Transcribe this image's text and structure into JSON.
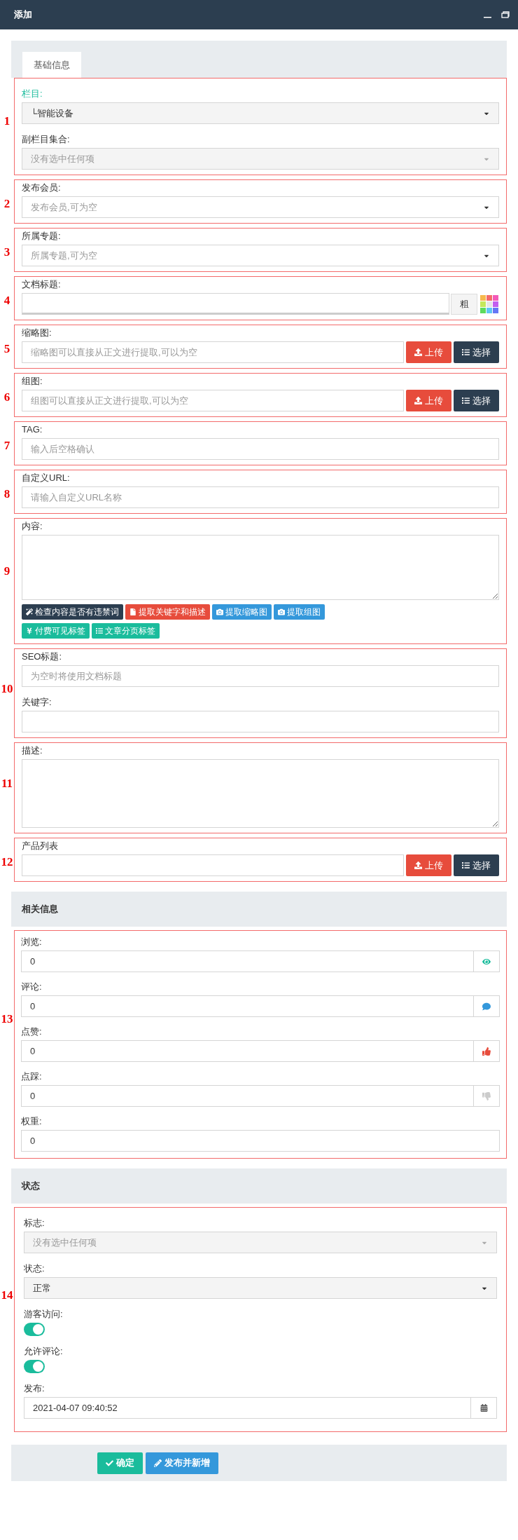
{
  "window": {
    "title": "添加"
  },
  "tabs": [
    {
      "label": "基础信息",
      "selected": true
    }
  ],
  "basic_groups": [
    {
      "number": "1",
      "fields": [
        {
          "kind": "select",
          "label": "栏目:",
          "focused": true,
          "value": "└智能设备",
          "disabled": false
        },
        {
          "kind": "select",
          "label": "副栏目集合:",
          "focused": false,
          "placeholder": "没有选中任何项",
          "disabled": true
        }
      ]
    },
    {
      "number": "2",
      "fields": [
        {
          "kind": "select",
          "label": "发布会员:",
          "focused": false,
          "placeholder": "发布会员,可为空",
          "disabled": false
        }
      ]
    },
    {
      "number": "3",
      "fields": [
        {
          "kind": "select",
          "label": "所属专题:",
          "focused": false,
          "placeholder": "所属专题,可为空",
          "disabled": false
        }
      ]
    },
    {
      "number": "4",
      "fields": [
        {
          "kind": "title",
          "label": "文档标题:",
          "focused": false,
          "bold_button": "粗"
        }
      ]
    },
    {
      "number": "5",
      "fields": [
        {
          "kind": "upload",
          "label": "缩略图:",
          "focused": false,
          "placeholder": "缩略图可以直接从正文进行提取,可以为空",
          "buttons": [
            {
              "kind": "upload",
              "label": "上传"
            },
            {
              "kind": "choose",
              "label": "选择"
            }
          ]
        }
      ]
    },
    {
      "number": "6",
      "fields": [
        {
          "kind": "upload",
          "label": "组图:",
          "focused": false,
          "placeholder": "组图可以直接从正文进行提取,可以为空",
          "buttons": [
            {
              "kind": "upload",
              "label": "上传"
            },
            {
              "kind": "choose",
              "label": "选择"
            }
          ]
        }
      ]
    },
    {
      "number": "7",
      "fields": [
        {
          "kind": "input",
          "label": "TAG:",
          "focused": false,
          "placeholder": "输入后空格确认"
        }
      ]
    },
    {
      "number": "8",
      "fields": [
        {
          "kind": "input",
          "label": "自定义URL:",
          "focused": false,
          "placeholder": "请输入自定义URL名称"
        }
      ]
    },
    {
      "number": "9",
      "fields": [
        {
          "kind": "editor",
          "label": "内容:",
          "focused": false,
          "tools": [
            {
              "kind": "wand",
              "label": "检查内容是否有违禁词",
              "color": "#2c3e50"
            },
            {
              "kind": "file",
              "label": "提取关键字和描述",
              "color": "#e74c3c"
            },
            {
              "kind": "camera",
              "label": "提取缩略图",
              "color": "#3498db"
            },
            {
              "kind": "camera",
              "label": "提取组图",
              "color": "#3498db"
            },
            {
              "kind": "yen",
              "label": "付费可见标签",
              "color": "#1abc9c"
            },
            {
              "kind": "list",
              "label": "文章分页标签",
              "color": "#1abc9c"
            }
          ]
        }
      ]
    },
    {
      "number": "10",
      "fields": [
        {
          "kind": "input",
          "label": "SEO标题:",
          "focused": false,
          "placeholder": "为空时将使用文档标题"
        },
        {
          "kind": "input",
          "label": "关键字:",
          "focused": false
        }
      ]
    },
    {
      "number": "11",
      "fields": [
        {
          "kind": "textarea",
          "label": "描述:",
          "focused": false
        }
      ]
    },
    {
      "number": "12",
      "fields": [
        {
          "kind": "upload",
          "label": "产品列表",
          "focused": false,
          "buttons": [
            {
              "kind": "upload",
              "label": "上传"
            },
            {
              "kind": "choose",
              "label": "选择"
            }
          ]
        }
      ]
    }
  ],
  "related": {
    "title": "相关信息",
    "number": "13",
    "fields": [
      {
        "label": "浏览:",
        "value": "0",
        "kind": "eye",
        "color": "#1abc9c"
      },
      {
        "label": "评论:",
        "value": "0",
        "kind": "comment",
        "color": "#3498db"
      },
      {
        "label": "点赞:",
        "value": "0",
        "kind": "like",
        "color": "#e74c3c"
      },
      {
        "label": "点踩:",
        "value": "0",
        "kind": "dislike",
        "color": "#cccccc"
      },
      {
        "label": "权重:",
        "value": "0"
      }
    ]
  },
  "status": {
    "title": "状态",
    "number": "14",
    "fields": [
      {
        "kind": "select",
        "label": "标志:",
        "placeholder": "没有选中任何项",
        "disabled": true
      },
      {
        "kind": "select",
        "label": "状态:",
        "value": "正常",
        "disabled": false
      },
      {
        "kind": "toggle",
        "label": "游客访问:",
        "on": true
      },
      {
        "kind": "toggle",
        "label": "允许评论:",
        "on": true
      },
      {
        "kind": "date",
        "label": "发布:",
        "value": "2021-04-07 09:40:52"
      }
    ]
  },
  "footer": {
    "buttons": [
      {
        "kind": "confirm",
        "label": "确定"
      },
      {
        "kind": "publish",
        "label": "发布并新增"
      }
    ]
  }
}
